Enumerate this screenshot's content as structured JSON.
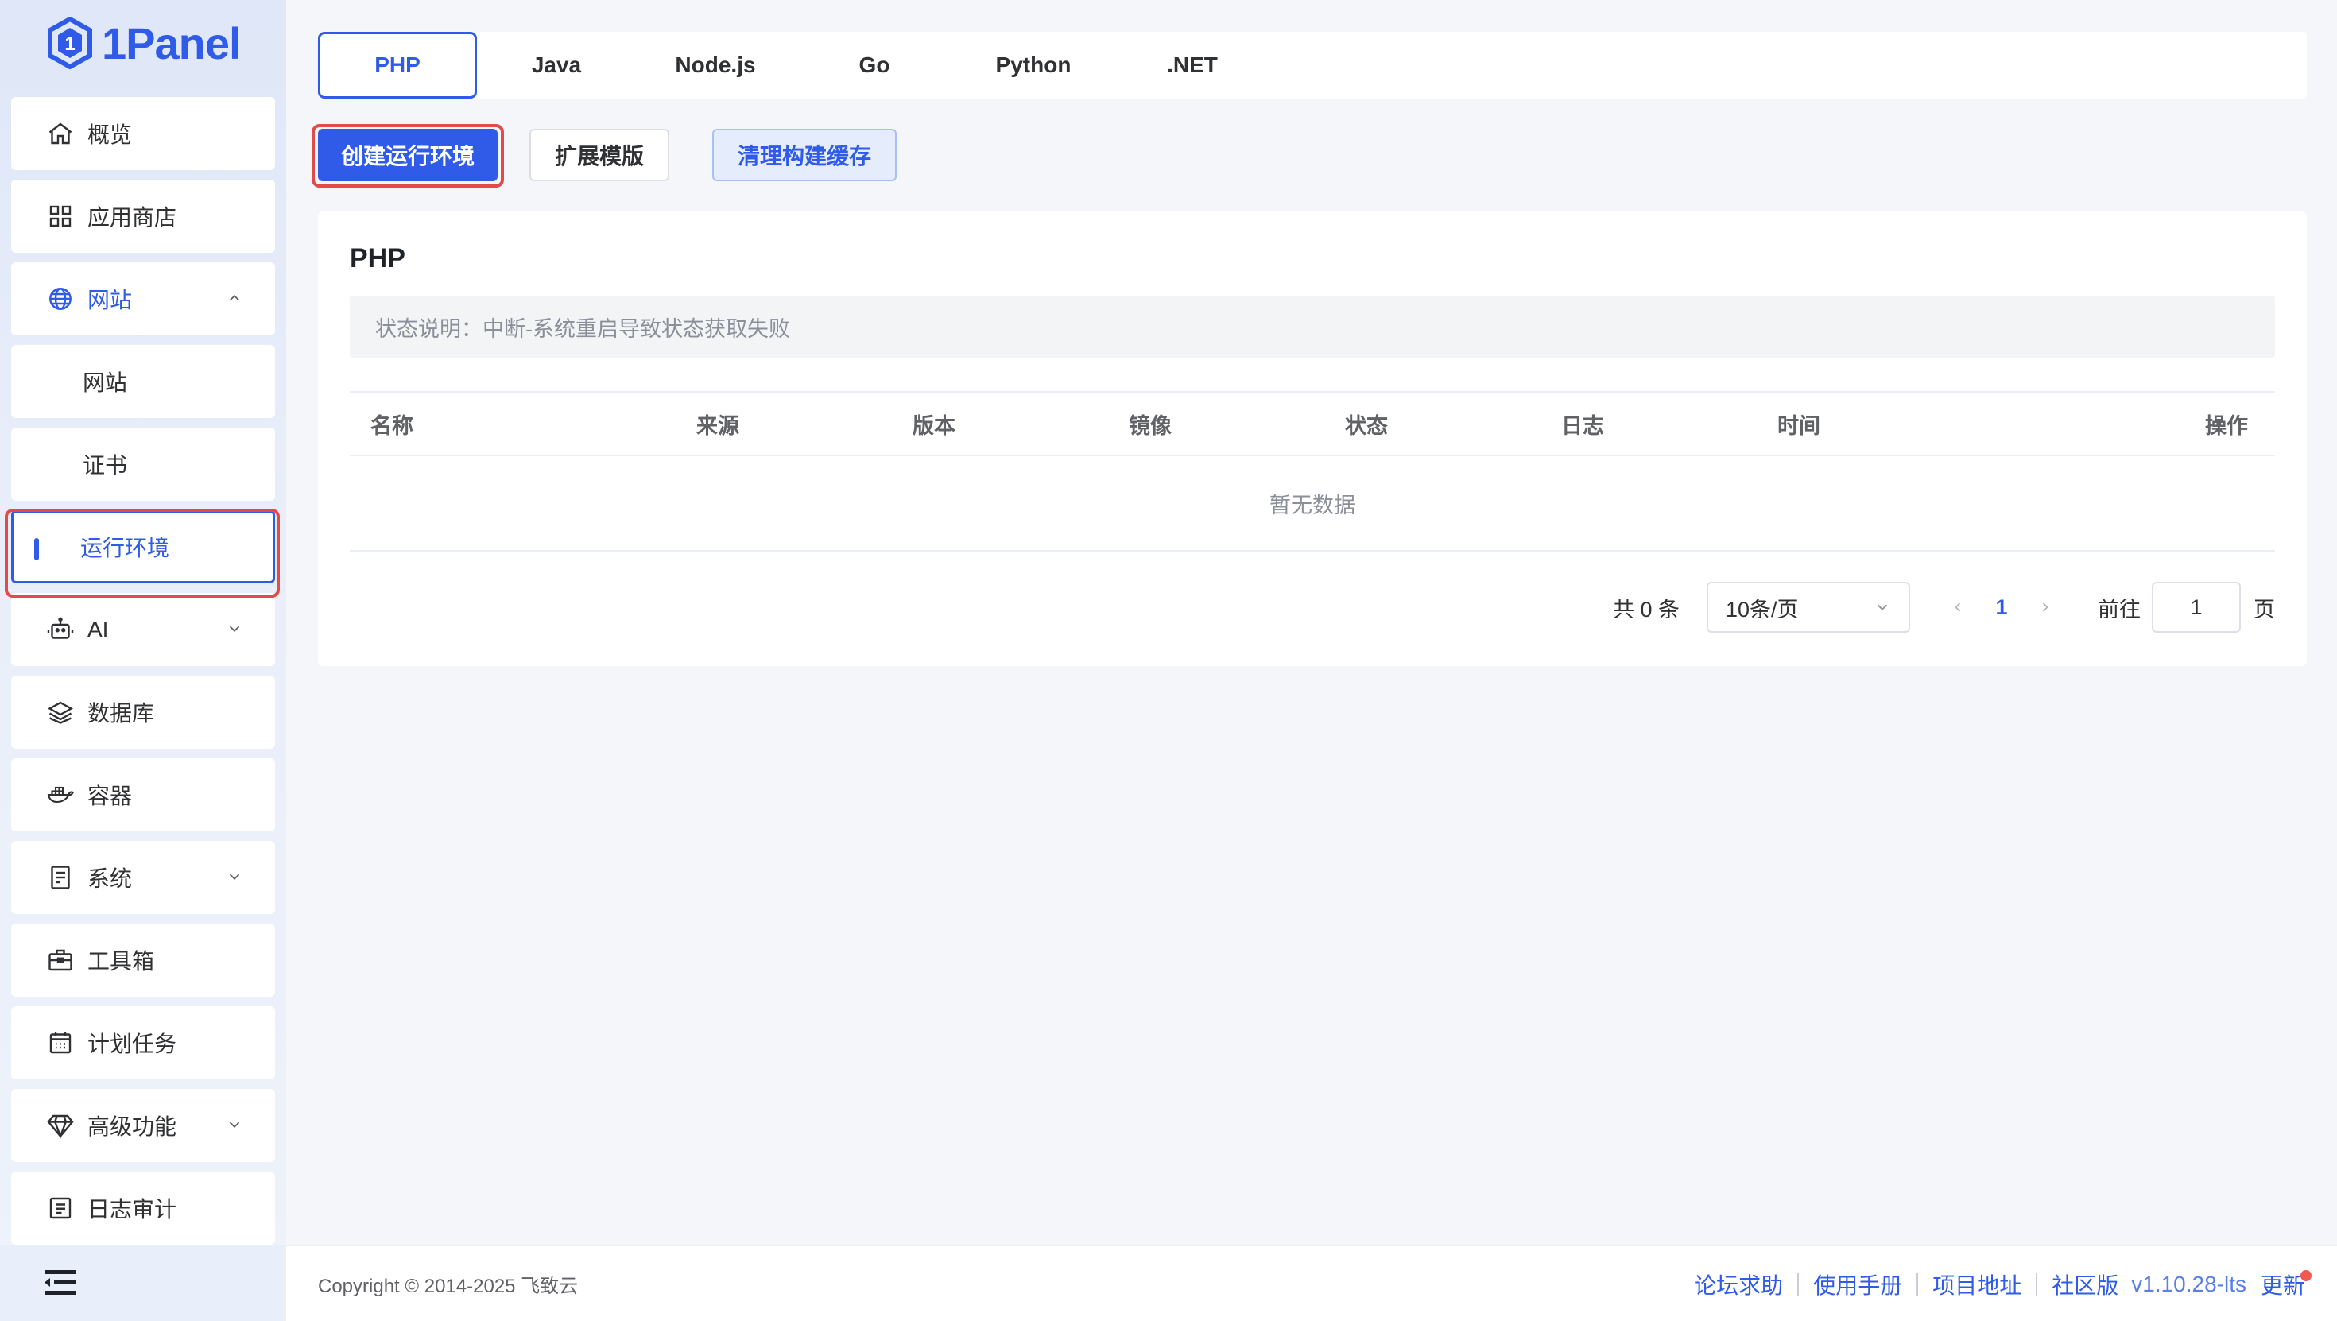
{
  "app": {
    "logo_text": "1Panel"
  },
  "sidebar": {
    "items": [
      {
        "label": "概览",
        "icon": "home-icon"
      },
      {
        "label": "应用商店",
        "icon": "grid-icon"
      },
      {
        "label": "网站",
        "icon": "globe-icon",
        "expanded": true
      },
      {
        "label": "网站"
      },
      {
        "label": "证书"
      },
      {
        "label": "运行环境",
        "selected": true
      },
      {
        "label": "AI",
        "icon": "robot-icon"
      },
      {
        "label": "数据库",
        "icon": "layers-icon"
      },
      {
        "label": "容器",
        "icon": "docker-icon"
      },
      {
        "label": "系统",
        "icon": "server-icon"
      },
      {
        "label": "工具箱",
        "icon": "toolbox-icon"
      },
      {
        "label": "计划任务",
        "icon": "calendar-icon"
      },
      {
        "label": "高级功能",
        "icon": "diamond-icon"
      },
      {
        "label": "日志审计",
        "icon": "log-icon"
      }
    ]
  },
  "tabs": [
    "PHP",
    "Java",
    "Node.js",
    "Go",
    "Python",
    ".NET"
  ],
  "actions": {
    "create": "创建运行环境",
    "extensions": "扩展模版",
    "clear_cache": "清理构建缓存"
  },
  "card": {
    "title": "PHP",
    "notice": "状态说明：中断-系统重启导致状态获取失败",
    "columns": [
      "名称",
      "来源",
      "版本",
      "镜像",
      "状态",
      "日志",
      "时间",
      "操作"
    ],
    "empty": "暂无数据"
  },
  "pagination": {
    "total": "共 0 条",
    "page_size": "10条/页",
    "current": "1",
    "goto_label": "前往",
    "goto_value": "1",
    "page_suffix": "页"
  },
  "footer": {
    "copyright": "Copyright © 2014-2025 飞致云",
    "links": [
      "论坛求助",
      "使用手册",
      "项目地址",
      "社区版"
    ],
    "version": "v1.10.28-lts",
    "update": "更新"
  },
  "colors": {
    "accent": "#2f5be8",
    "highlight": "#e04b4b"
  }
}
